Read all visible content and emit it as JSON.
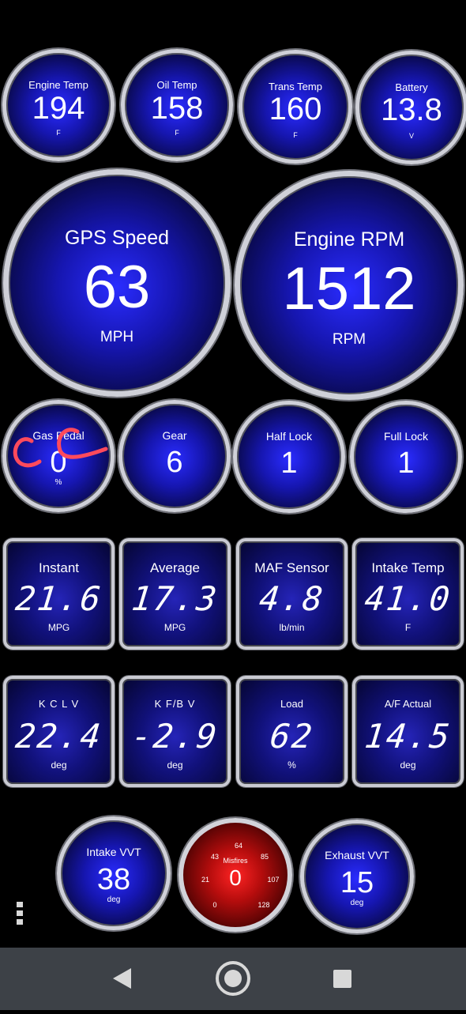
{
  "top_gauges": [
    {
      "label": "Engine Temp",
      "value": "194",
      "unit": "F"
    },
    {
      "label": "Oil Temp",
      "value": "158",
      "unit": "F"
    },
    {
      "label": "Trans Temp",
      "value": "160",
      "unit": "F"
    },
    {
      "label": "Battery",
      "value": "13.8",
      "unit": "V"
    }
  ],
  "big_gauges": [
    {
      "label": "GPS Speed",
      "value": "63",
      "unit": "MPH"
    },
    {
      "label": "Engine RPM",
      "value": "1512",
      "unit": "RPM"
    }
  ],
  "mid_gauges": [
    {
      "label": "Gas Pedal",
      "value": "0",
      "unit": "%"
    },
    {
      "label": "Gear",
      "value": "6",
      "unit": ""
    },
    {
      "label": "Half Lock",
      "value": "1",
      "unit": ""
    },
    {
      "label": "Full Lock",
      "value": "1",
      "unit": ""
    }
  ],
  "panels_row1": [
    {
      "label": "Instant",
      "value": "21.6",
      "unit": "MPG"
    },
    {
      "label": "Average",
      "value": "17.3",
      "unit": "MPG"
    },
    {
      "label": "MAF Sensor",
      "value": "4.8",
      "unit": "lb/min"
    },
    {
      "label": "Intake Temp",
      "value": "41.0",
      "unit": "F"
    }
  ],
  "panels_row2": [
    {
      "label": "K C L V",
      "value": "22.4",
      "unit": "deg"
    },
    {
      "label": "K F/B V",
      "value": "-2.9",
      "unit": "deg"
    },
    {
      "label": "Load",
      "value": "62",
      "unit": "%"
    },
    {
      "label": "A/F Actual",
      "value": "14.5",
      "unit": "deg"
    }
  ],
  "bottom_gauges": [
    {
      "label": "Intake VVT",
      "value": "38",
      "unit": "deg"
    },
    {
      "label": "Exhaust VVT",
      "value": "15",
      "unit": "deg"
    }
  ],
  "misfires": {
    "label": "Misfires",
    "value": "0",
    "ticks": [
      "0",
      "21",
      "43",
      "64",
      "85",
      "107",
      "128"
    ]
  },
  "colors": {
    "gauge_blue": "#1616b0",
    "misfire_red": "#b60d0d",
    "annotation": "#ff4a5c",
    "navbar": "#3d4147"
  },
  "icons": {
    "menu": "more-vertical-icon",
    "back": "back-triangle-icon",
    "home": "home-circle-icon",
    "recent": "recent-square-icon"
  }
}
